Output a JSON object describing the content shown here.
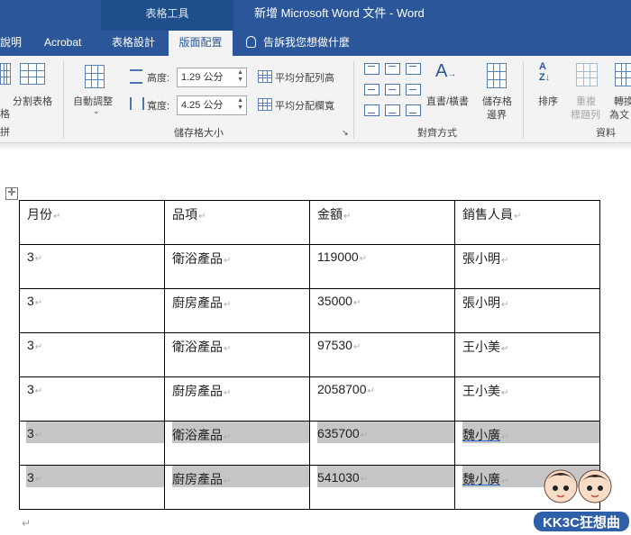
{
  "titlebar": {
    "context_tools": "表格工具",
    "document_title": "新增 Microsoft Word 文件  -  Word"
  },
  "tabs": {
    "help": "說明",
    "acrobat": "Acrobat",
    "table_design": "表格設計",
    "layout": "版面配置",
    "tell_me": "告訴我您想做什麼"
  },
  "ribbon": {
    "split_table": "分割表格",
    "merge_cut": "格",
    "merge_group_cut": "拼",
    "autofit": "自動調整",
    "height_label": "高度:",
    "height_value": "1.29 公分",
    "width_label": "寬度:",
    "width_value": "4.25 公分",
    "distribute_rows": "平均分配列高",
    "distribute_cols": "平均分配欄寬",
    "cell_size_group": "儲存格大小",
    "text_direction": "直書/橫書",
    "cell_margins_1": "儲存格",
    "cell_margins_2": "邊界",
    "alignment_group": "對齊方式",
    "sort": "排序",
    "repeat_header_1": "重複",
    "repeat_header_2": "標題列",
    "convert_1": "轉換",
    "convert_2": "為文",
    "data_group": "資料"
  },
  "table": {
    "headers": [
      "月份",
      "品項",
      "金額",
      "銷售人員"
    ],
    "rows": [
      [
        "3",
        "衛浴產品",
        "119000",
        "張小明"
      ],
      [
        "3",
        "廚房產品",
        "35000",
        "張小明"
      ],
      [
        "3",
        "衛浴產品",
        "97530",
        "王小美"
      ],
      [
        "3",
        "廚房產品",
        "2058700",
        "王小美"
      ],
      [
        "3",
        "衛浴產品",
        "635700",
        "魏小廣"
      ],
      [
        "3",
        "廚房產品",
        "541030",
        "魏小廣"
      ]
    ],
    "paragraph_mark": "↵"
  },
  "watermark": {
    "logo_text": "KK3C狂想曲"
  },
  "colors": {
    "word_blue": "#2b579a",
    "ribbon_bg": "#f3f3f3",
    "selection": "#c6c6c6"
  }
}
